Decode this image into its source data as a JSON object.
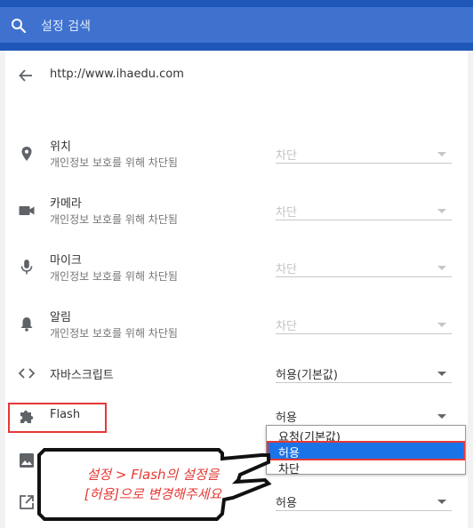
{
  "search": {
    "placeholder": "설정 검색",
    "icon": "search-icon"
  },
  "header": {
    "back_icon": "arrow-back-icon",
    "site_url": "http://www.ihaedu.com"
  },
  "rows": [
    {
      "icon": "location-pin-icon",
      "title": "위치",
      "subtitle": "개인정보 보호를 위해 차단됨",
      "value": "차단",
      "disabled": true
    },
    {
      "icon": "camera-icon",
      "title": "카메라",
      "subtitle": "개인정보 보호를 위해 차단됨",
      "value": "차단",
      "disabled": true
    },
    {
      "icon": "microphone-icon",
      "title": "마이크",
      "subtitle": "개인정보 보호를 위해 차단됨",
      "value": "차단",
      "disabled": true
    },
    {
      "icon": "bell-icon",
      "title": "알림",
      "subtitle": "개인정보 보호를 위해 차단됨",
      "value": "차단",
      "disabled": true
    },
    {
      "icon": "code-icon",
      "title": "자바스크립트",
      "value": "허용(기본값)",
      "disabled": false
    },
    {
      "icon": "puzzle-icon",
      "title": "Flash",
      "value": "허용",
      "disabled": false
    },
    {
      "icon": "image-icon",
      "title": "",
      "value": "",
      "disabled": false
    },
    {
      "icon": "external-link-icon",
      "title": "",
      "value": "허용",
      "disabled": false
    }
  ],
  "dropdown": {
    "options": [
      "요청(기본값)",
      "허용",
      "차단"
    ],
    "selected": "허용"
  },
  "callout": {
    "line1": "설정 > Flash의 설정을",
    "line2": "[허용]으로 변경해주세요"
  },
  "colors": {
    "topbar": "#1e57b8",
    "search_box": "#3f72cf",
    "highlight_red": "#e53935",
    "selection_blue": "#1b73e8"
  }
}
